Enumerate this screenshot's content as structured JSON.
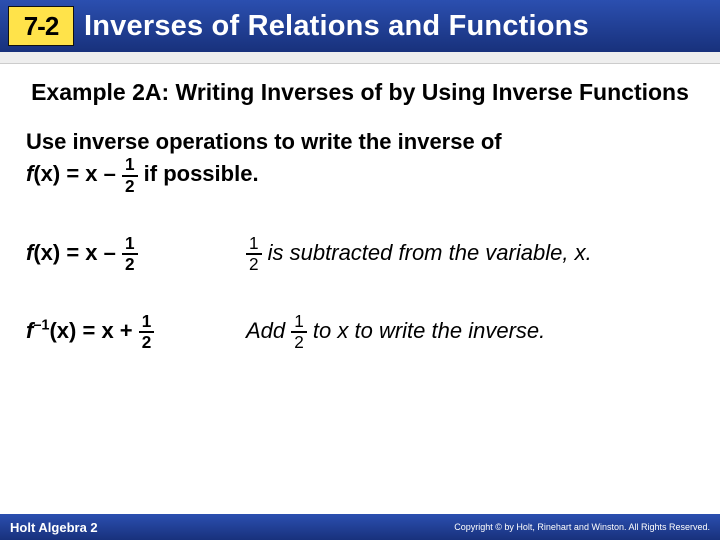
{
  "header": {
    "badge": "7-2",
    "title": "Inverses of Relations and Functions"
  },
  "example_title": "Example 2A: Writing Inverses of by Using Inverse Functions",
  "prompt": {
    "pre": "Use inverse operations to write the inverse of ",
    "func_label": "f",
    "func_arg": "(x) = x – ",
    "frac_num": "1",
    "frac_den": "2",
    "post": " if possible."
  },
  "rows": [
    {
      "lhs": {
        "f": "f",
        "arg": "(x) = x – ",
        "num": "1",
        "den": "2",
        "sup": ""
      },
      "rhs": {
        "num": "1",
        "den": "2",
        "text": " is subtracted from the variable, x."
      }
    },
    {
      "lhs": {
        "f": "f",
        "sup": "–1",
        "arg": "(x) = x + ",
        "num": "1",
        "den": "2"
      },
      "rhs": {
        "pre": "Add ",
        "num": "1",
        "den": "2",
        "text": " to x to write the inverse."
      }
    }
  ],
  "footer": {
    "left": "Holt Algebra 2",
    "right": "Copyright © by Holt, Rinehart and Winston. All Rights Reserved."
  }
}
